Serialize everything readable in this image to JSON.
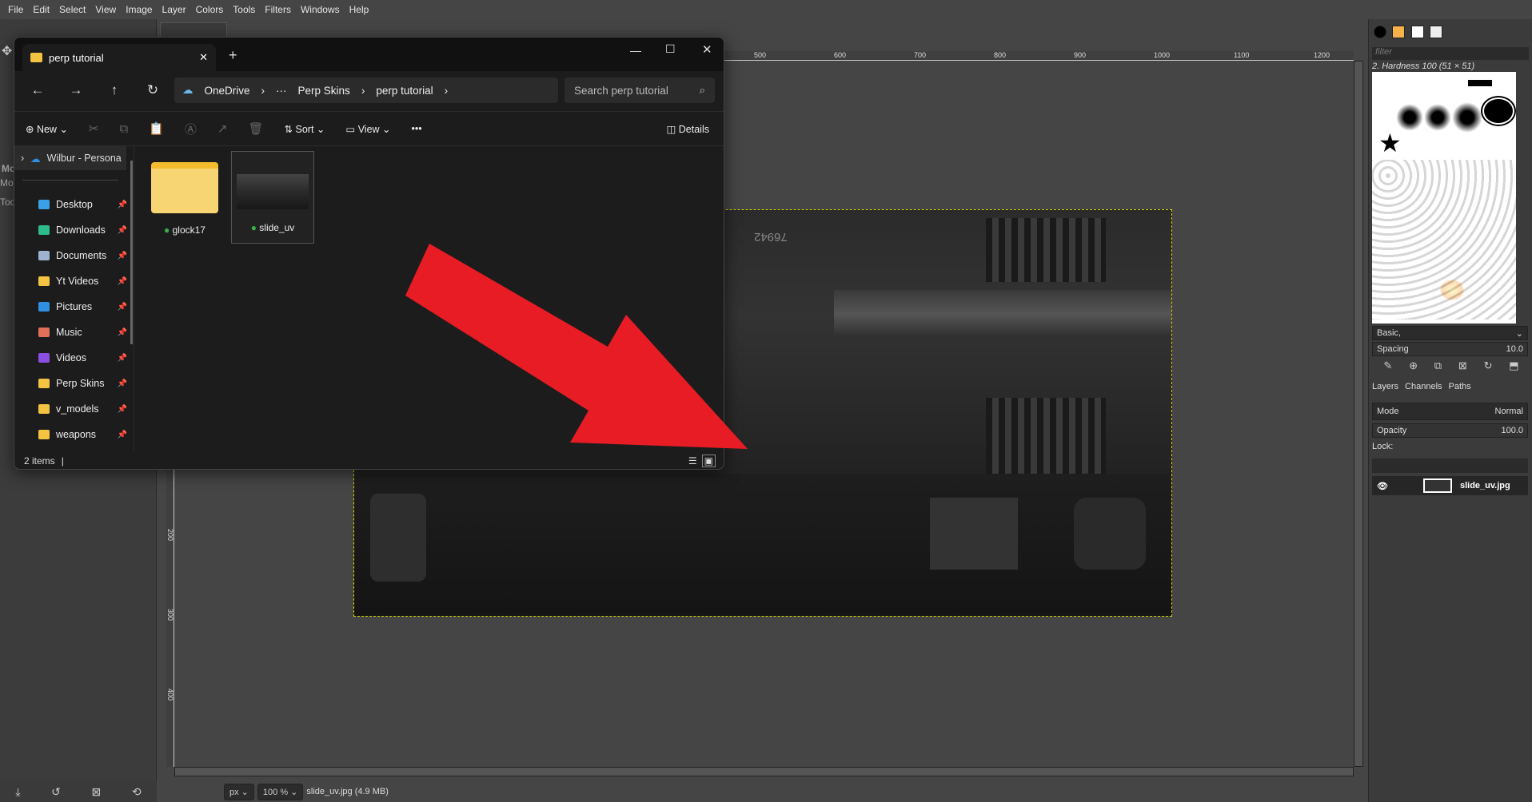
{
  "gimp": {
    "menu": [
      "File",
      "Edit",
      "Select",
      "View",
      "Image",
      "Layer",
      "Colors",
      "Tools",
      "Filters",
      "Windows",
      "Help"
    ],
    "toolbox_labels": [
      "Mo",
      "Mov",
      "Too"
    ],
    "ruler_top": [
      "500",
      "600",
      "700",
      "800",
      "900",
      "1000",
      "1100",
      "1200"
    ],
    "ruler_left": [
      "200",
      "300",
      "400"
    ],
    "status": {
      "unit": "px",
      "zoom": "100 %",
      "file_info": "slide_uv.jpg (4.9 MB)"
    },
    "image_label": "76942",
    "dock": {
      "filter_placeholder": "filter",
      "brush_name": "2. Hardness 100 (51 × 51)",
      "tag_select": "Basic,",
      "spacing_label": "Spacing",
      "spacing_value": "10.0",
      "tabs": [
        "Layers",
        "Channels",
        "Paths"
      ],
      "mode_label": "Mode",
      "mode_value": "Normal",
      "opacity_label": "Opacity",
      "opacity_value": "100.0",
      "lock_label": "Lock:",
      "layer_name": "slide_uv.jpg"
    }
  },
  "explorer": {
    "tab_title": "perp tutorial",
    "breadcrumb": [
      "OneDrive",
      "···",
      "Perp Skins",
      "perp tutorial"
    ],
    "search_placeholder": "Search perp tutorial",
    "toolbar": {
      "new": "New",
      "sort": "Sort",
      "view": "View",
      "more": "•••",
      "details": "Details"
    },
    "nav_root": "Wilbur - Persona",
    "nav": [
      {
        "label": "Desktop",
        "color": "#3aa0e8"
      },
      {
        "label": "Downloads",
        "color": "#2dbb8a"
      },
      {
        "label": "Documents",
        "color": "#9fb3d1"
      },
      {
        "label": "Yt Videos",
        "color": "#f5c342"
      },
      {
        "label": "Pictures",
        "color": "#2f8fe0"
      },
      {
        "label": "Music",
        "color": "#e0705a"
      },
      {
        "label": "Videos",
        "color": "#8a4fe0"
      },
      {
        "label": "Perp Skins",
        "color": "#f5c342"
      },
      {
        "label": "v_models",
        "color": "#f5c342"
      },
      {
        "label": "weapons",
        "color": "#f5c342"
      }
    ],
    "files": [
      {
        "name": "glock17",
        "type": "folder"
      },
      {
        "name": "slide_uv",
        "type": "image"
      }
    ],
    "status": "2 items"
  },
  "annotation": {
    "arrow_color": "#e81c24"
  }
}
